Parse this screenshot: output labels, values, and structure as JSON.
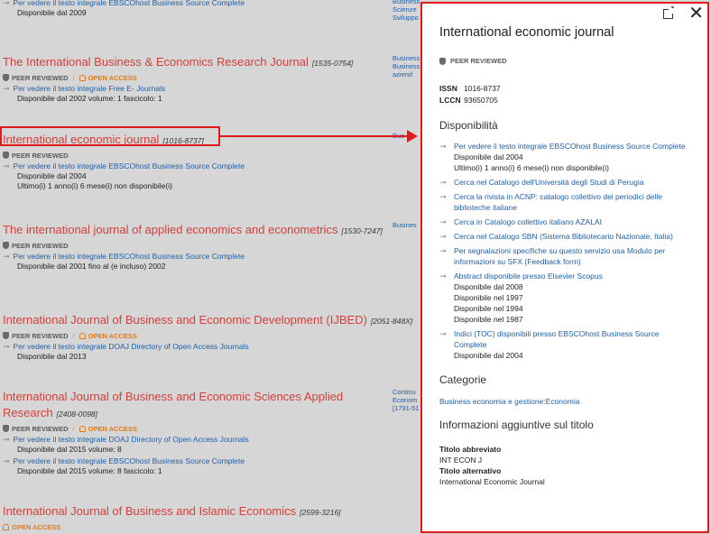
{
  "entries": [
    {
      "title": "",
      "issn": "",
      "badges": [],
      "links": [
        {
          "text": "Per vedere il testo integrale EBSCOhost Business Source Complete",
          "notes": [
            "Disponibile dal 2009"
          ]
        }
      ]
    },
    {
      "title": "The International Business & Economics Research Journal",
      "issn": "[1535-0754]",
      "badges": [
        "PEER REVIEWED",
        "OPEN ACCESS"
      ],
      "links": [
        {
          "text": "Per vedere il testo integrale Free E- Journals",
          "notes": [
            "Disponibile dal 2002 volume: 1 fascicolo: 1"
          ]
        }
      ]
    },
    {
      "title": "International economic journal",
      "issn": "[1016-8737]",
      "badges": [
        "PEER REVIEWED"
      ],
      "links": [
        {
          "text": "Per vedere il testo integrale EBSCOhost Business Source Complete",
          "notes": [
            "Disponibile dal 2004",
            "Ultimo(i) 1 anno(i) 6 mese(i) non disponibile(i)"
          ]
        }
      ]
    },
    {
      "title": "The international journal of applied economics and econometrics",
      "issn": "[1530-7247]",
      "badges": [
        "PEER REVIEWED"
      ],
      "links": [
        {
          "text": "Per vedere il testo integrale EBSCOhost Business Source Complete",
          "notes": [
            "Disponibile dal 2001 fino al (e incluso) 2002"
          ]
        }
      ]
    },
    {
      "title": "International Journal of Business and Economic Development (IJBED)",
      "issn": "[2051-848X]",
      "badges": [
        "PEER REVIEWED",
        "OPEN ACCESS"
      ],
      "links": [
        {
          "text": "Per vedere il testo integrale DOAJ Directory of Open Access Journals",
          "notes": [
            "Disponibile dal 2013"
          ]
        }
      ]
    },
    {
      "title": "International Journal of Business and Economic Sciences Applied Research",
      "issn": "[2408-0098]",
      "badges": [
        "PEER REVIEWED",
        "OPEN ACCESS"
      ],
      "links": [
        {
          "text": "Per vedere il testo integrale DOAJ Directory of Open Access Journals",
          "notes": [
            "Disponibile dal 2015 volume: 8"
          ]
        },
        {
          "text": "Per vedere il testo integrale EBSCOhost Business Source Complete",
          "notes": [
            "Disponibile dal 2015 volume: 8 fascicolo: 1"
          ]
        }
      ]
    },
    {
      "title": "International Journal of Business and Islamic Economics",
      "issn": "[2599-3216]",
      "badges": [
        "OPEN ACCESS"
      ],
      "links": []
    }
  ],
  "side_cols": [
    [
      "Business",
      "Scienze",
      "Sviluppo"
    ],
    [
      "Business",
      "Business",
      "aziend"
    ],
    [
      "Bus"
    ],
    [
      "Busines"
    ],
    [
      "Continu",
      "Econom",
      "[1791-51"
    ]
  ],
  "panel": {
    "title": "International economic journal",
    "peer": "PEER REVIEWED",
    "issn_label": "ISSN",
    "issn_value": "1016-8737",
    "lccn_label": "LCCN",
    "lccn_value": "93650705",
    "availability_heading": "Disponibilità",
    "availability": [
      {
        "text": "Per vedere il testo integrale EBSCOhost Business Source Complete",
        "notes": [
          "Disponibile dal 2004",
          "Ultimo(i) 1 anno(i) 6 mese(i) non disponibile(i)"
        ]
      },
      {
        "text": "Cerca nel Catalogo dell'Università degli Studi di Perugia",
        "notes": []
      },
      {
        "text": "Cerca la rivista in ACNP: catalogo collettivo dei periodici delle biblioteche italiane",
        "notes": []
      },
      {
        "text": "Cerca in Catalogo collettivo italiano AZALAI",
        "notes": []
      },
      {
        "text": "Cerca nel Catalogo SBN (Sistema Bibliotecario Nazionale, Italia)",
        "notes": []
      },
      {
        "text": "Per segnalazioni specifiche su questo servizio usa Modulo per informazioni su SFX (Feedback form)",
        "notes": []
      },
      {
        "text": "Abstract disponibile presso Elsevier Scopus",
        "notes": [
          "Disponibile dal 2008",
          "Disponibile nel 1997",
          "Disponibile nel 1994",
          "Disponibile nel 1987"
        ]
      },
      {
        "text": "Indici (TOC) disponibili presso EBSCOhost Business Source Complete",
        "notes": [
          "Disponibile dal 2004"
        ]
      }
    ],
    "categories_heading": "Categorie",
    "category_link": "Business economia e gestione:Economia",
    "info_heading": "Informazioni aggiuntive sul titolo",
    "abbrev_label": "Titolo abbreviato",
    "abbrev_value": "INT ECON J",
    "alt_label": "Titolo alternativo",
    "alt_value": "International Economic Journal"
  },
  "colors": {
    "highlight": "#e0191b",
    "title_red": "#d43f3a",
    "link_blue": "#1f5fa7",
    "open_access": "#e07a1f"
  }
}
